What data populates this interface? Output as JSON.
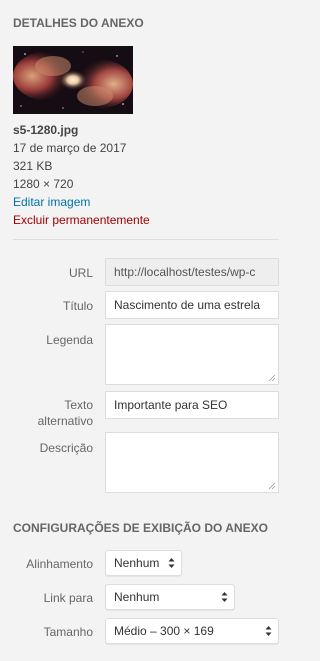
{
  "attachment_details": {
    "heading": "DETALHES DO ANEXO",
    "filename": "s5-1280.jpg",
    "date": "17 de março de 2017",
    "filesize": "321 KB",
    "dimensions": "1280 × 720",
    "edit_link": "Editar imagem",
    "delete_link": "Excluir permanentemente",
    "thumbnail_icon": "nebula-thumbnail"
  },
  "fields": {
    "url": {
      "label": "URL",
      "value": "http://localhost/testes/wp-c"
    },
    "title": {
      "label": "Título",
      "value": "Nascimento de uma estrela"
    },
    "caption": {
      "label": "Legenda",
      "value": ""
    },
    "alt": {
      "label_line1": "Texto",
      "label_line2": "alternativo",
      "value": "Importante para SEO"
    },
    "description": {
      "label": "Descrição",
      "value": ""
    }
  },
  "display_settings": {
    "heading": "CONFIGURAÇÕES DE EXIBIÇÃO DO ANEXO",
    "alignment": {
      "label": "Alinhamento",
      "selected": "Nenhum"
    },
    "link_to": {
      "label": "Link para",
      "selected": "Nenhum"
    },
    "size": {
      "label": "Tamanho",
      "selected": "Médio – 300 × 169"
    }
  },
  "colors": {
    "background": "#f3f3f3",
    "link": "#0073aa",
    "delete": "#a00000"
  }
}
